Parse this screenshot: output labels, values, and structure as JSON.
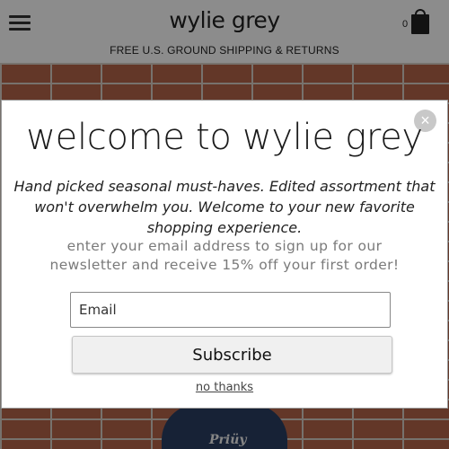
{
  "header": {
    "logo": "wylie grey",
    "shipping_banner": "FREE U.S. GROUND SHIPPING & RETURNS",
    "cart_count": "0",
    "menu_icon": "hamburger-menu-icon",
    "cart_icon": "shopping-bag-icon"
  },
  "hero": {
    "shirt_text": "Priüy"
  },
  "modal": {
    "title": "welcome to wylie grey",
    "tagline": "Hand picked seasonal must-haves. Edited assortment that won't overwhelm you. Welcome to your new favorite shopping experience.",
    "offer": "enter your email address to sign up for our newsletter and receive 15% off your first order!",
    "email_placeholder": "Email",
    "subscribe_label": "Subscribe",
    "no_thanks_label": "no thanks",
    "close_icon": "close-icon",
    "close_symbol": "×"
  },
  "colors": {
    "overlay": "rgba(0,0,0,0.45)",
    "brick": "#b5644a",
    "button_bg": "#f0f0f0",
    "close_bg": "#c8c8c8"
  }
}
